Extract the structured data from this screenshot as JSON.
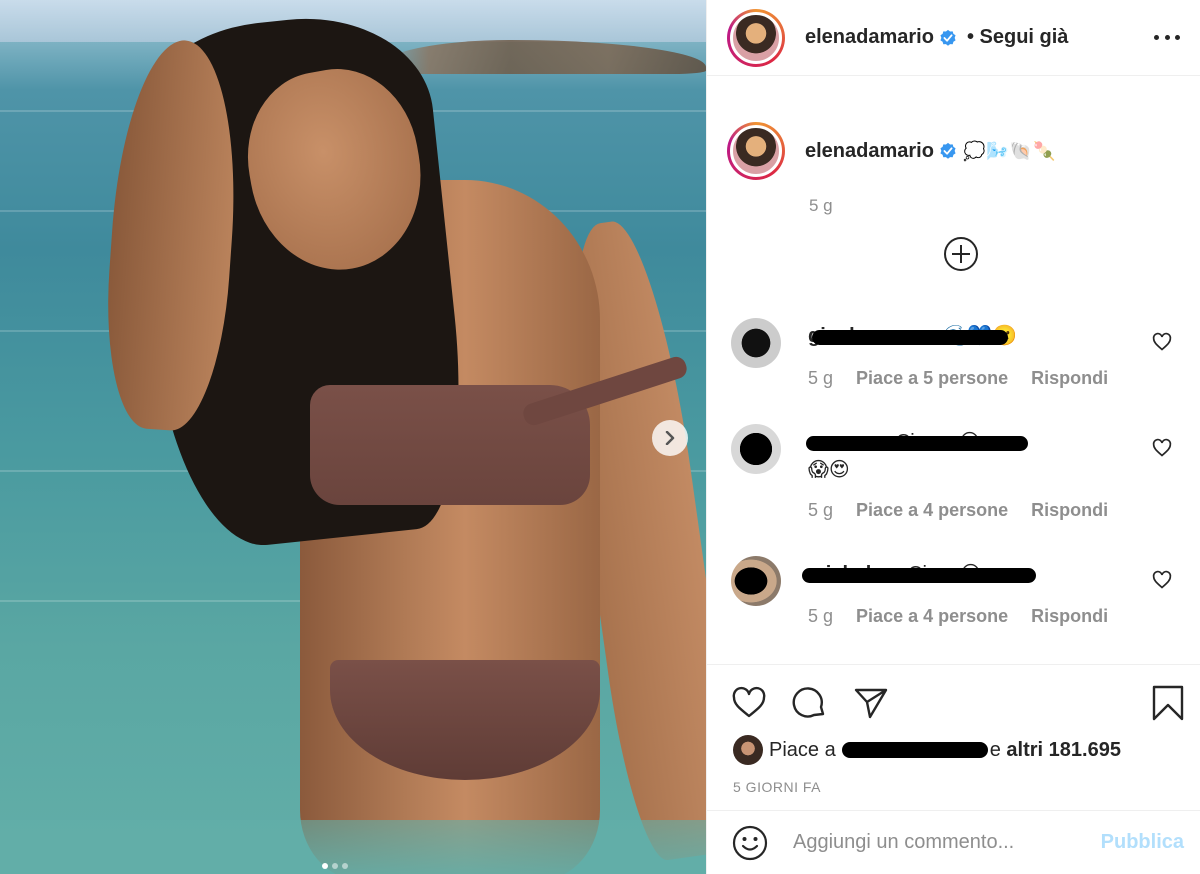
{
  "post": {
    "author": "elenadamario",
    "follow_status": "• Segui già",
    "caption_emojis": "💭🌬️🐚🍡",
    "caption_time": "5 g",
    "photo_alt": "",
    "carousel_total": 3,
    "carousel_index": 1
  },
  "icons": {
    "verified": "verified-badge-icon",
    "more": "more-options-icon",
    "load_more": "add-circle-icon",
    "like": "heart-icon",
    "comment": "comment-icon",
    "share": "paper-plane-icon",
    "save": "bookmark-icon",
    "emoji": "smiley-icon",
    "next": "chevron-right-icon"
  },
  "comments": [
    {
      "user": "gianl…_…_…",
      "text": "🌊💙🙂",
      "time": "5 g",
      "likes": "Piace a 5 persone",
      "reply": "Rispondi"
    },
    {
      "user": "…_…_…",
      "text": "Ciaone😍",
      "text_line2": "😱😍",
      "time": "5 g",
      "likes": "Piace a 4 persone",
      "reply": "Rispondi"
    },
    {
      "user": "michela…",
      "text": "Ciao. 😍",
      "time": "5 g",
      "likes": "Piace a 4 persone",
      "reply": "Rispondi"
    }
  ],
  "likes_line": {
    "prefix": "Piace a",
    "suffix": "e",
    "others": "altri 181.695"
  },
  "posted_ago": "5 GIORNI FA",
  "composer": {
    "placeholder": "Aggiungi un commento...",
    "publish_label": "Pubblica"
  },
  "colors": {
    "accent_blue": "#0095f6",
    "publish_disabled": "#b2dffc",
    "muted_text": "#8e8e8e"
  }
}
